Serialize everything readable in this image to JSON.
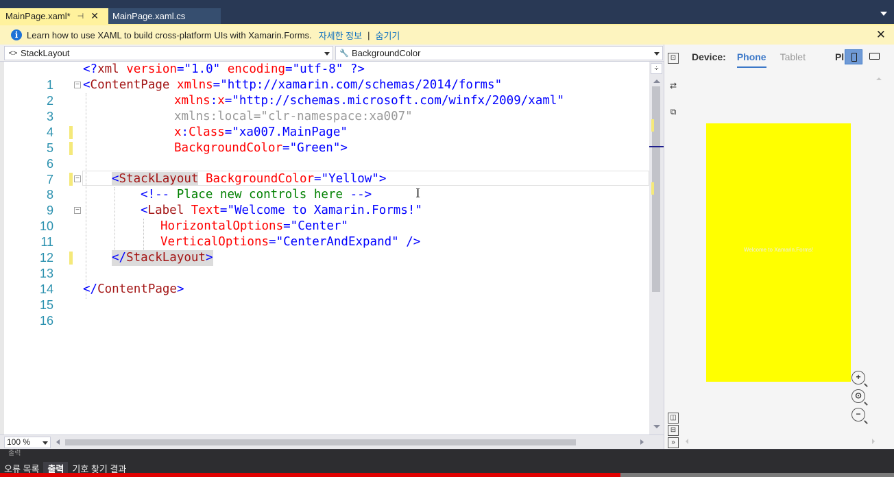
{
  "tabs": [
    {
      "label": "MainPage.xaml*",
      "active": true,
      "pinned": true
    },
    {
      "label": "MainPage.xaml.cs",
      "active": false
    }
  ],
  "infobar": {
    "message": "Learn how to use XAML to build cross-platform UIs with Xamarin.Forms.",
    "link": "자세한 정보",
    "separator": "|",
    "hide": "숨기기",
    "close": "✕"
  },
  "nav": {
    "left_label": "StackLayout",
    "left_icon": "element-icon",
    "right_label": "BackgroundColor",
    "right_icon": "wrench-icon"
  },
  "code_lines": [
    {
      "num": "1",
      "text": "<?xml version=\"1.0\" encoding=\"utf-8\" ?>"
    },
    {
      "num": "2",
      "text": "<ContentPage xmlns=\"http://xamarin.com/schemas/2014/forms\""
    },
    {
      "num": "3",
      "text": "xmlns:x=\"http://schemas.microsoft.com/winfx/2009/xaml\""
    },
    {
      "num": "4",
      "text": "xmlns:local=\"clr-namespace:xa007\""
    },
    {
      "num": "5",
      "text": "x:Class=\"xa007.MainPage\""
    },
    {
      "num": "6",
      "text": "BackgroundColor=\"Green\">"
    },
    {
      "num": "7",
      "text": ""
    },
    {
      "num": "8",
      "text": "<StackLayout BackgroundColor=\"Yellow\">"
    },
    {
      "num": "9",
      "text": "<!-- Place new controls here -->"
    },
    {
      "num": "10",
      "text": "<Label Text=\"Welcome to Xamarin.Forms!\""
    },
    {
      "num": "11",
      "text": "HorizontalOptions=\"Center\""
    },
    {
      "num": "12",
      "text": "VerticalOptions=\"CenterAndExpand\" />"
    },
    {
      "num": "13",
      "text": "</StackLayout>"
    },
    {
      "num": "14",
      "text": ""
    },
    {
      "num": "15",
      "text": "</ContentPage>"
    },
    {
      "num": "16",
      "text": ""
    }
  ],
  "code_tokens": {
    "l1_a": "<?",
    "l1_b": "xml",
    "l1_c": " version",
    "l1_d": "=\"",
    "l1_e": "1.0",
    "l1_f": "\"",
    "l1_g": " encoding",
    "l1_h": "=\"",
    "l1_i": "utf-8",
    "l1_j": "\" ?>",
    "l2_a": "<",
    "l2_b": "ContentPage",
    "l2_c": " xmlns",
    "l2_d": "=\"",
    "l2_e": "http://xamarin.com/schemas/2014/forms",
    "l2_f": "\"",
    "l3_a": "xmlns",
    "l3_b": ":",
    "l3_c": "x",
    "l3_d": "=\"",
    "l3_e": "http://schemas.microsoft.com/winfx/2009/xaml",
    "l3_f": "\"",
    "l4": "xmlns:local=\"clr-namespace:xa007\"",
    "l5_a": "x",
    "l5_b": ":",
    "l5_c": "Class",
    "l5_d": "=\"",
    "l5_e": "xa007.MainPage",
    "l5_f": "\"",
    "l6_a": "BackgroundColor",
    "l6_b": "=\"",
    "l6_c": "Green",
    "l6_d": "\">",
    "l8_a": "<",
    "l8_b": "StackLayout",
    "l8_c": " BackgroundColor",
    "l8_d": "=\"",
    "l8_e": "Yellow",
    "l8_f": "\">",
    "l9_a": "<!--",
    "l9_b": " Place new controls here ",
    "l9_c": "-->",
    "l10_a": "<",
    "l10_b": "Label",
    "l10_c": " Text",
    "l10_d": "=\"",
    "l10_e": "Welcome to Xamarin.Forms!",
    "l10_f": "\"",
    "l11_a": "HorizontalOptions",
    "l11_b": "=\"",
    "l11_c": "Center",
    "l11_d": "\"",
    "l12_a": "VerticalOptions",
    "l12_b": "=\"",
    "l12_c": "CenterAndExpand",
    "l12_d": "\" />",
    "l13_a": "</",
    "l13_b": "StackLayout",
    "l13_c": ">",
    "l15_a": "</",
    "l15_b": "ContentPage",
    "l15_c": ">"
  },
  "editor": {
    "zoom": "100 %"
  },
  "previewer": {
    "device_label": "Device:",
    "phone": "Phone",
    "tablet": "Tablet",
    "platform_partial": "Pl",
    "screen_color": "#ffff00",
    "screen_text": "Welcome to Xamarin.Forms!"
  },
  "bottom_panel": {
    "header": "출력",
    "tabs": [
      "오류 목록",
      "출력",
      "기호 찾기 결과"
    ],
    "active_tab": "출력"
  },
  "colors": {
    "tab_active": "#fff29d",
    "tab_bar": "#293955",
    "infobar": "#fdf4bf",
    "change_marker": "#f5e97a"
  }
}
